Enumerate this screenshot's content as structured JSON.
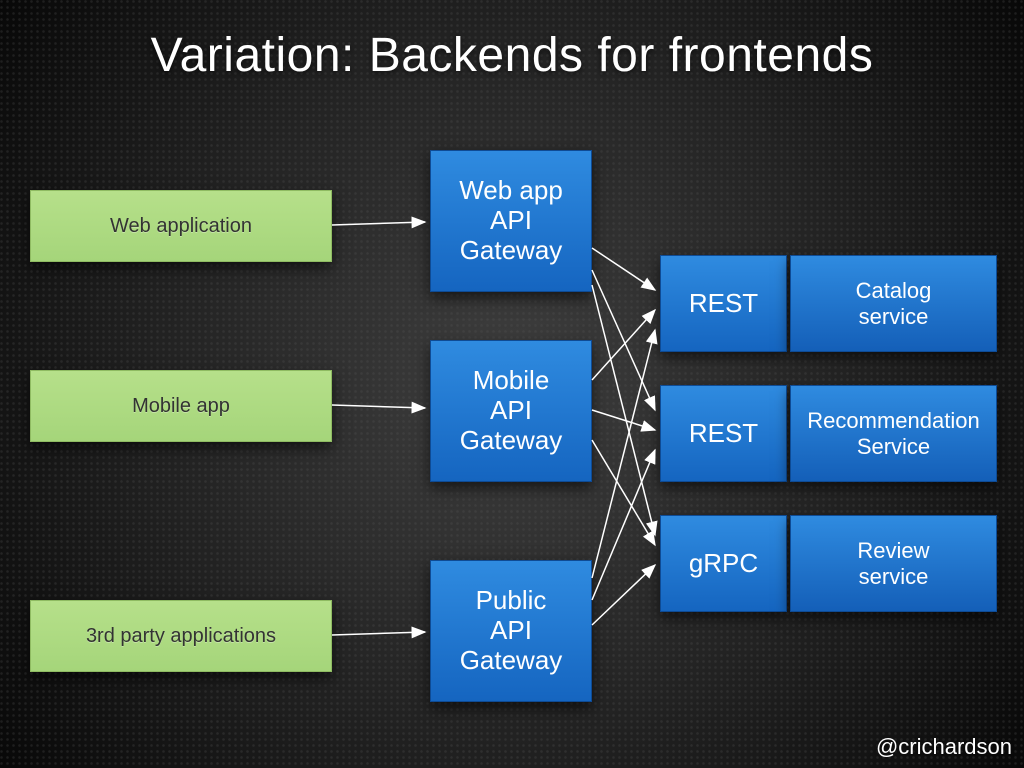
{
  "title": "Variation: Backends for frontends",
  "attribution": "@crichardson",
  "clients": [
    {
      "label": "Web application"
    },
    {
      "label": "Mobile app"
    },
    {
      "label": "3rd party applications"
    }
  ],
  "gateways": [
    {
      "label": "Web app\nAPI\nGateway"
    },
    {
      "label": "Mobile\nAPI\nGateway"
    },
    {
      "label": "Public\nAPI\nGateway"
    }
  ],
  "services": [
    {
      "protocol": "REST",
      "name": "Catalog\nservice"
    },
    {
      "protocol": "REST",
      "name": "Recommendation\nService"
    },
    {
      "protocol": "gRPC",
      "name": "Review\nservice"
    }
  ],
  "colors": {
    "client_bg": "#a5d57a",
    "gateway_bg": "#1565c0",
    "arrow": "#ffffff"
  }
}
